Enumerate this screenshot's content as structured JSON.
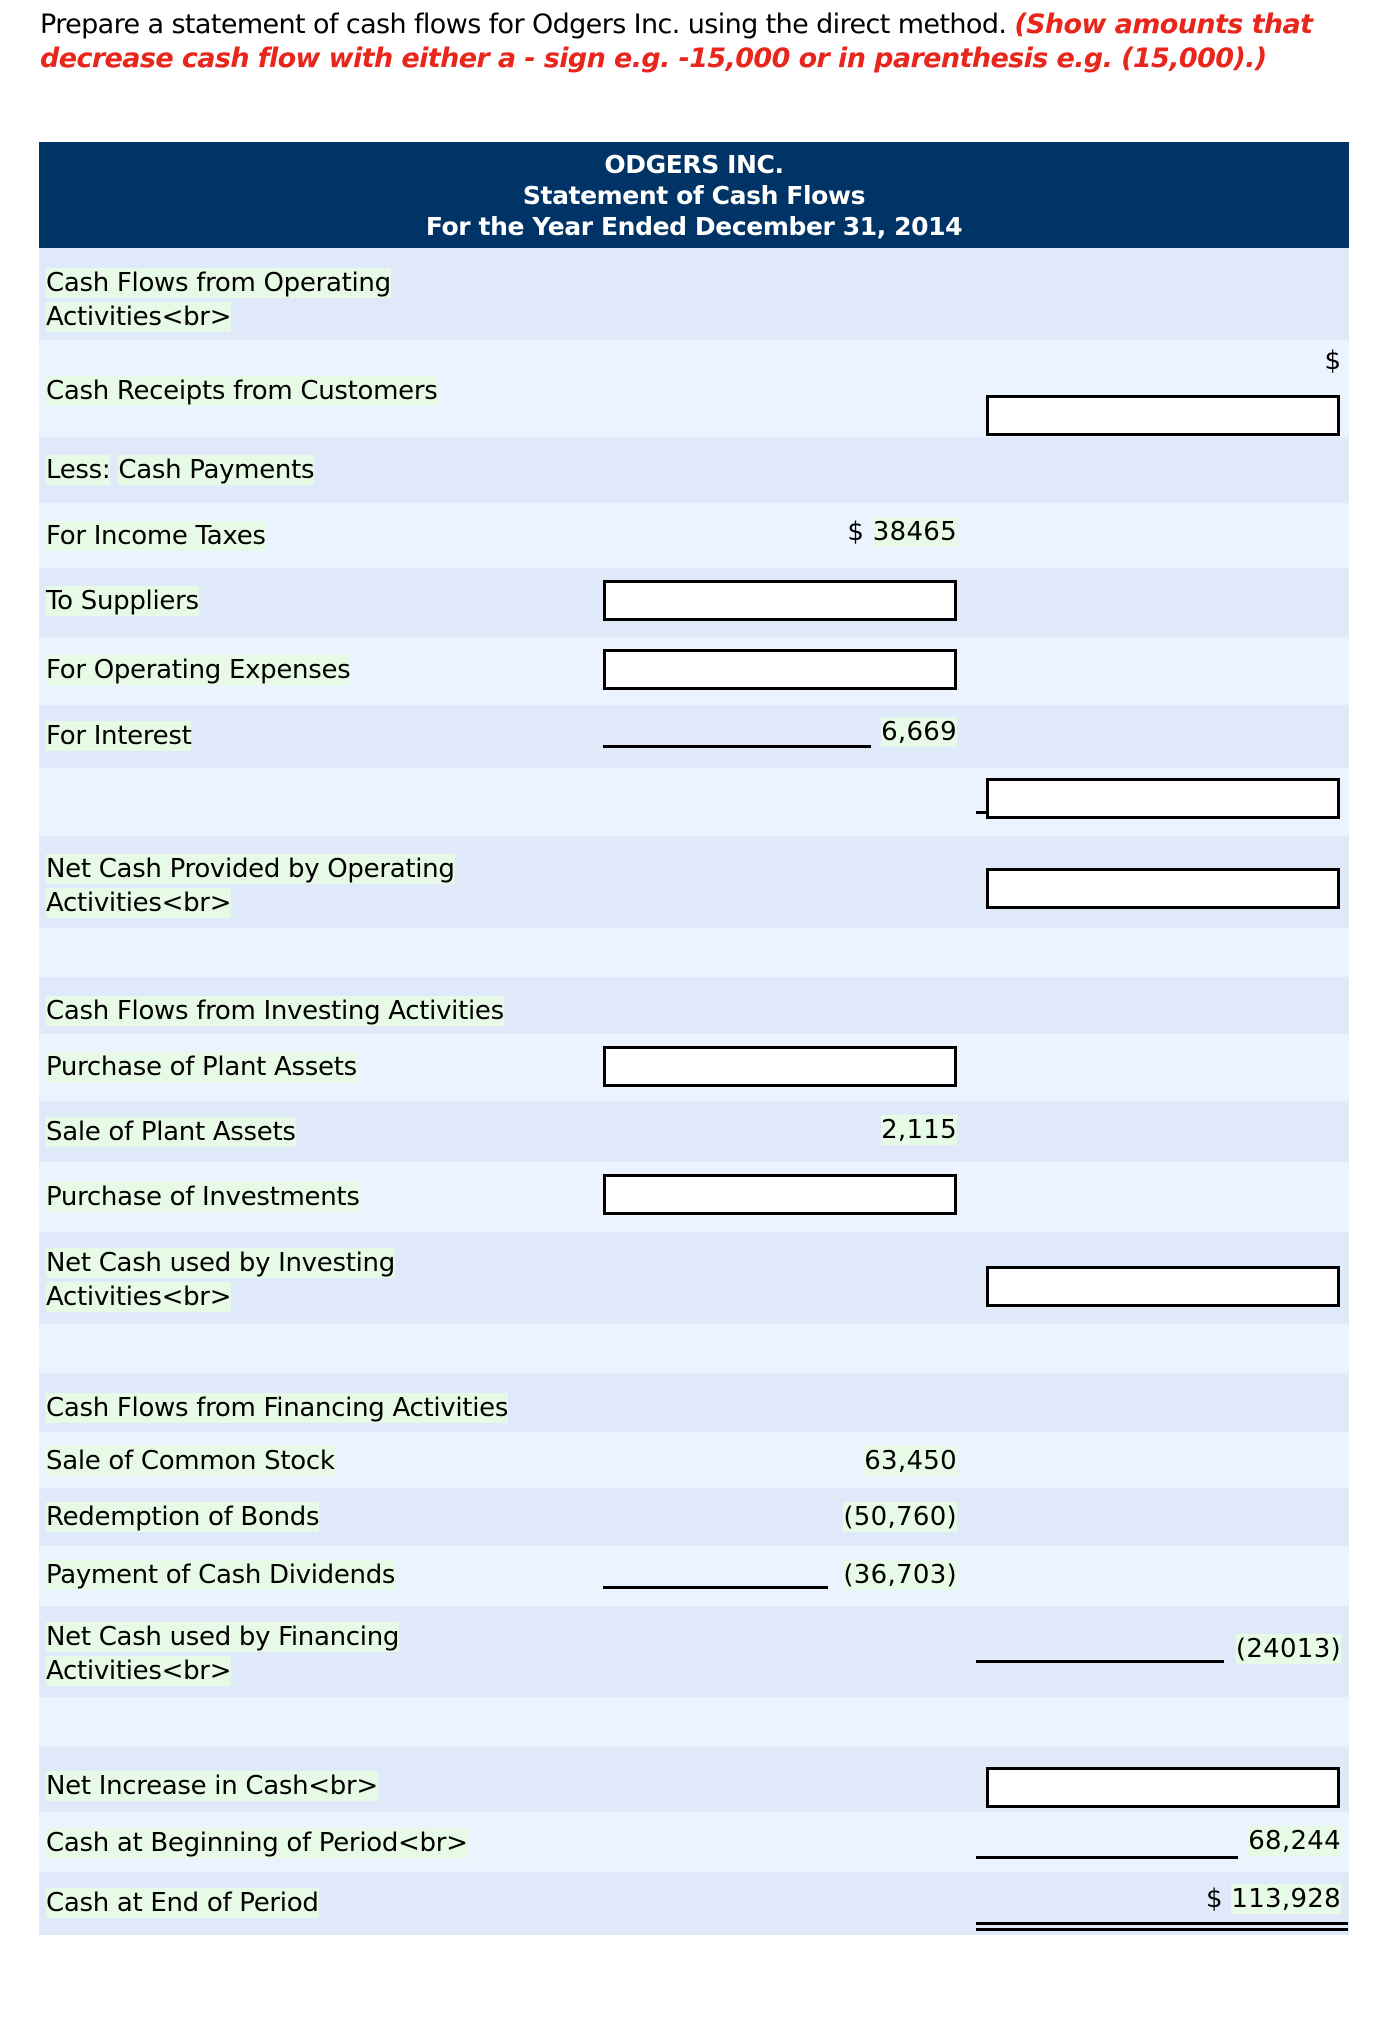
{
  "instructions": {
    "text": "Prepare a statement of cash flows for Odgers Inc. using the direct method. ",
    "note": "(Show amounts that decrease cash flow with either a - sign e.g. -15,000 or in parenthesis e.g. (15,000).)"
  },
  "header": {
    "company": "ODGERS INC.",
    "statement": "Statement of Cash Flows",
    "period": "For the Year Ended December 31, 2014"
  },
  "colors": {
    "header_bg": "#003366",
    "note_red": "#e8261c",
    "row_dark": "#dfe9f9",
    "row_light": "#ebf3fe"
  },
  "operating": {
    "heading_line1": "Cash Flows from Operating",
    "heading_line2": "Activities<br>",
    "receipts_label": "Cash Receipts from Customers",
    "receipts_currency": "$",
    "receipts_value": "",
    "less_label": "Less:",
    "less_label2": "Cash Payments",
    "income_taxes_label": "For Income Taxes",
    "income_taxes_currency": "$",
    "income_taxes_value": "38465",
    "suppliers_label": "To Suppliers",
    "suppliers_value": "",
    "opex_label": "For Operating Expenses",
    "opex_value": "",
    "interest_label": "For Interest",
    "interest_value": "6,669",
    "total_payments_value": "",
    "net_line1": "Net Cash Provided by Operating",
    "net_line2": "Activities<br>",
    "net_value": ""
  },
  "investing": {
    "heading": "Cash Flows from Investing Activities",
    "purchase_plant_label": "Purchase of Plant Assets",
    "purchase_plant_value": "",
    "sale_plant_label": "Sale of Plant Assets",
    "sale_plant_value": "2,115",
    "purchase_inv_label": "Purchase of Investments",
    "purchase_inv_value": "",
    "net_line1": "Net Cash used by Investing",
    "net_line2": "Activities<br>",
    "net_value": ""
  },
  "financing": {
    "heading": "Cash Flows from Financing Activities",
    "stock_label": "Sale of Common Stock",
    "stock_value": "63,450",
    "bonds_label": "Redemption of Bonds",
    "bonds_value": "(50,760)",
    "dividends_label": "Payment of Cash Dividends",
    "dividends_value": "(36,703)",
    "net_line1": "Net Cash used by Financing",
    "net_line2": "Activities<br>",
    "net_value": "(24013)"
  },
  "summary": {
    "increase_label": "Net Increase in Cash<br>",
    "increase_value": "",
    "begin_label": "Cash at Beginning of Period<br>",
    "begin_value": "68,244",
    "end_label": "Cash at End of Period",
    "end_currency": "$",
    "end_value": "113,928"
  }
}
